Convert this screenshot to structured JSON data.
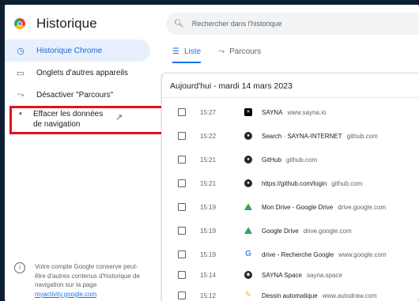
{
  "app": {
    "title": "Historique"
  },
  "search": {
    "placeholder": "Rechercher dans l'historique"
  },
  "sidebar": {
    "items": [
      {
        "label": "Historique Chrome",
        "icon": "clock-icon"
      },
      {
        "label": "Onglets d'autres appareils",
        "icon": "devices-icon"
      },
      {
        "label": "Désactiver \"Parcours\"",
        "icon": "journeys-off-icon"
      },
      {
        "label": "Effacer les données de navigation",
        "icon": "trash-icon"
      }
    ],
    "footer_text": "Votre compte Google conserve peut-être d'autres contenus d'historique de navigation sur la page",
    "footer_link": "myactivity.google.com"
  },
  "tabs": [
    {
      "label": "Liste",
      "icon": "list-icon"
    },
    {
      "label": "Parcours",
      "icon": "journeys-icon"
    }
  ],
  "history": {
    "date_header": "Aujourd'hui - mardi 14 mars 2023",
    "rows": [
      {
        "time": "15:27",
        "title": "SAYNA",
        "domain": "www.sayna.io",
        "icon": "sayna-icon"
      },
      {
        "time": "15:22",
        "title": "Search · SAYNA-INTERNET",
        "domain": "github.com",
        "icon": "github-icon"
      },
      {
        "time": "15:21",
        "title": "GitHub",
        "domain": "github.com",
        "icon": "github-icon"
      },
      {
        "time": "15:21",
        "title": "https://github.com/login",
        "domain": "github.com",
        "icon": "github-icon"
      },
      {
        "time": "15:19",
        "title": "Mon Drive - Google Drive",
        "domain": "drive.google.com",
        "icon": "drive-icon"
      },
      {
        "time": "15:19",
        "title": "Google Drive",
        "domain": "drive.google.com",
        "icon": "drive-icon"
      },
      {
        "time": "15:19",
        "title": "drive - Recherche Google",
        "domain": "www.google.com",
        "icon": "google-icon"
      },
      {
        "time": "15:14",
        "title": "SAYNA Space",
        "domain": "sayna.space",
        "icon": "sayna-space-icon"
      },
      {
        "time": "15:12",
        "title": "Dessin automatique",
        "domain": "www.autodraw.com",
        "icon": "autodraw-icon"
      }
    ]
  },
  "colors": {
    "accent": "#1a73e8",
    "highlight_box": "#e1141b",
    "active_bg": "#e8f0fe"
  }
}
